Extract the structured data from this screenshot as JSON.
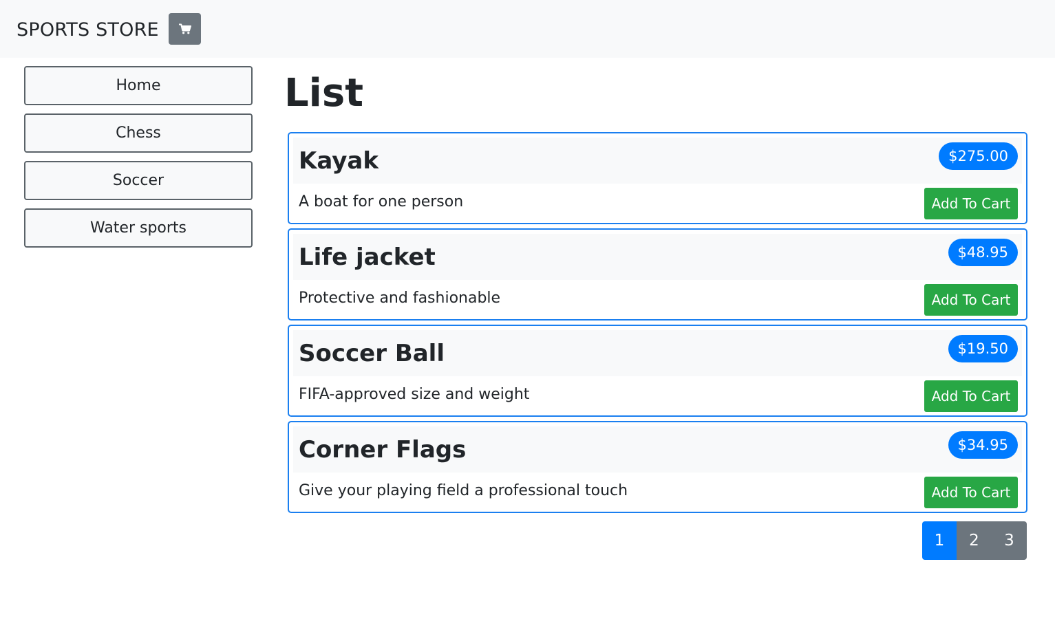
{
  "navbar": {
    "brand": "SPORTS STORE",
    "cart_icon": "shopping-cart-icon"
  },
  "sidebar": {
    "categories": [
      {
        "label": "Home"
      },
      {
        "label": "Chess"
      },
      {
        "label": "Soccer"
      },
      {
        "label": "Water sports"
      }
    ]
  },
  "main": {
    "title": "List",
    "products": [
      {
        "name": "Kayak",
        "price": "$275.00",
        "description": "A boat for one person",
        "button_label": "Add To Cart"
      },
      {
        "name": "Life jacket",
        "price": "$48.95",
        "description": "Protective and fashionable",
        "button_label": "Add To Cart"
      },
      {
        "name": "Soccer Ball",
        "price": "$19.50",
        "description": "FIFA-approved size and weight",
        "button_label": "Add To Cart"
      },
      {
        "name": "Corner Flags",
        "price": "$34.95",
        "description": "Give your playing field a professional touch",
        "button_label": "Add To Cart"
      }
    ],
    "pagination": {
      "pages": [
        "1",
        "2",
        "3"
      ],
      "current": "1"
    }
  },
  "colors": {
    "navbar_bg": "#f8f9fa",
    "primary": "#007bff",
    "success": "#28a745",
    "secondary": "#6c757d"
  }
}
